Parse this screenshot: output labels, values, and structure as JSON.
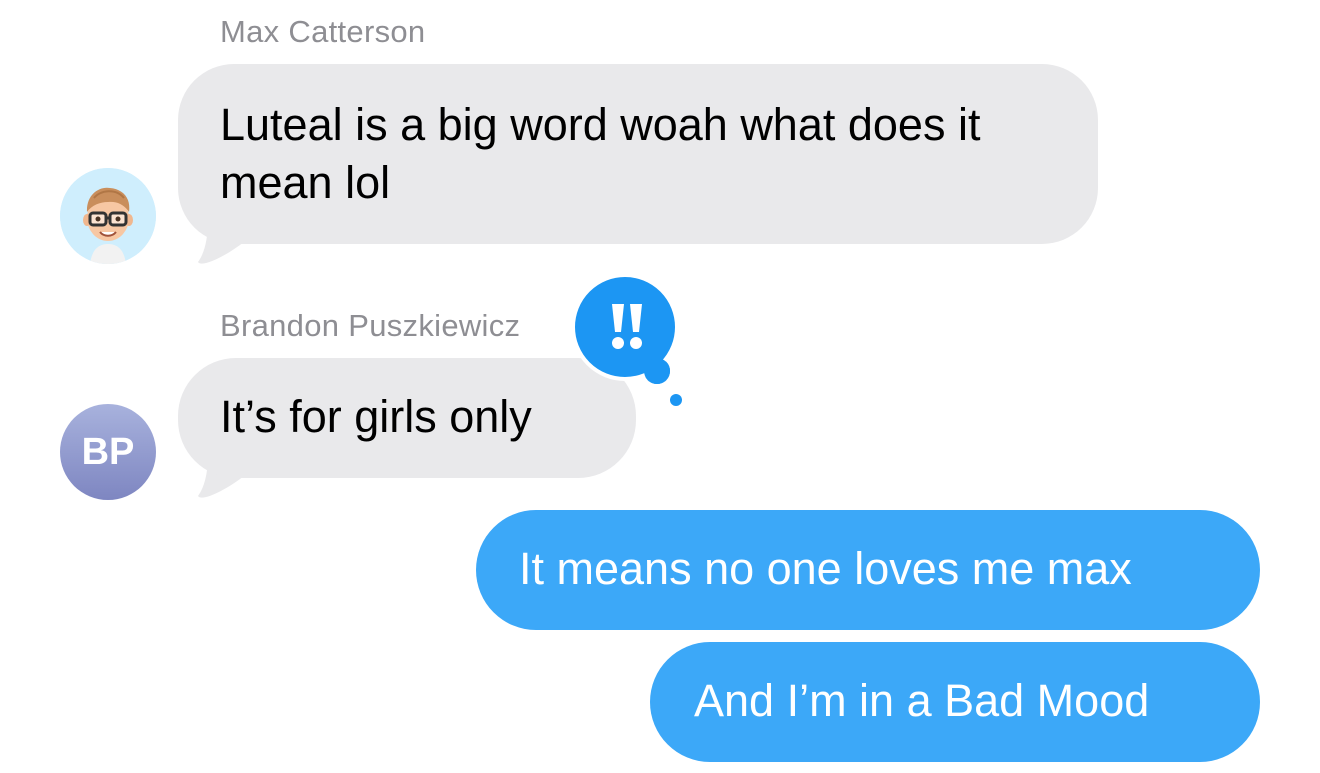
{
  "messages": [
    {
      "sender": "Max Catterson",
      "text": "Luteal is a big word woah what does it mean lol",
      "direction": "incoming",
      "avatar": "memoji-avatar"
    },
    {
      "sender": "Brandon Puszkiewicz",
      "avatar_initials": "BP",
      "text": "It’s for girls only",
      "direction": "incoming",
      "tapback": "exclamation-tapback-icon"
    },
    {
      "text": "It means no one loves me max",
      "direction": "outgoing"
    },
    {
      "text": "And I’m in a Bad Mood",
      "direction": "outgoing"
    }
  ],
  "colors": {
    "incoming_bubble": "#e9e9eb",
    "outgoing_bubble": "#3ca8f8",
    "tapback_blue": "#1c96f3",
    "sender_name_gray": "#8e8e93",
    "initials_avatar": "#8f97cf",
    "memoji_background": "#cfeefd"
  }
}
